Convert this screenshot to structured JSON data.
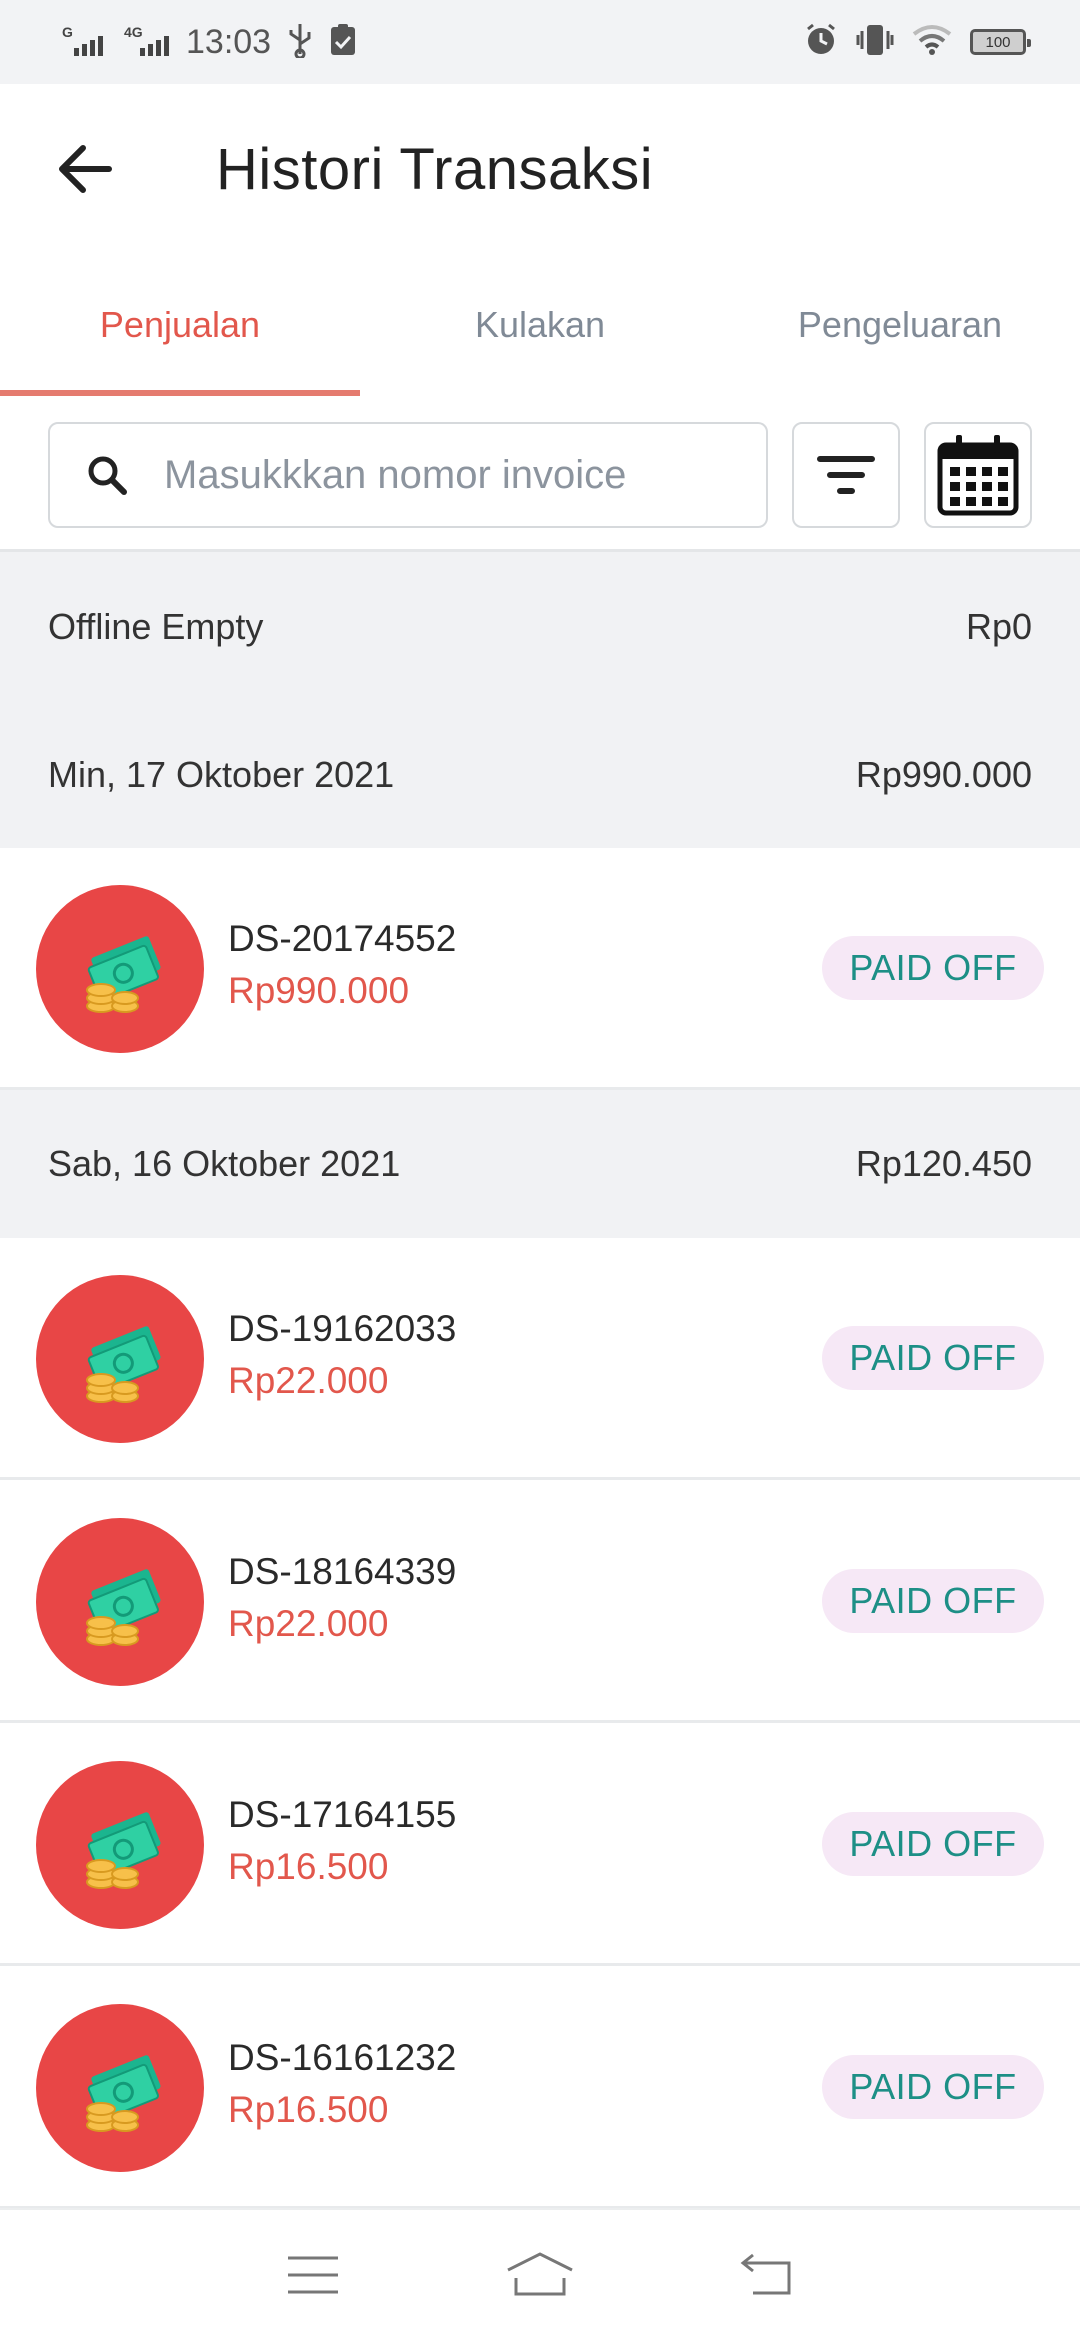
{
  "status_bar": {
    "network1": "G",
    "network2": "4G",
    "time": "13:03",
    "battery": "100",
    "icons": [
      "usb-icon",
      "clipboard-check-icon",
      "alarm-icon",
      "vibrate-icon",
      "wifi-icon",
      "battery-icon"
    ]
  },
  "header": {
    "title": "Histori Transaksi",
    "back_icon": "arrow-left-icon"
  },
  "tabs": [
    {
      "label": "Penjualan",
      "active": true
    },
    {
      "label": "Kulakan",
      "active": false
    },
    {
      "label": "Pengeluaran",
      "active": false
    }
  ],
  "search": {
    "placeholder": "Masukkkan nomor invoice",
    "value": "",
    "icon": "search-icon",
    "filter_icon": "filter-icon",
    "calendar_icon": "calendar-icon"
  },
  "offline": {
    "label": "Offline Empty",
    "amount": "Rp0"
  },
  "groups": [
    {
      "date": "Min, 17 Oktober 2021",
      "total": "Rp990.000",
      "transactions": [
        {
          "invoice": "DS-20174552",
          "amount": "Rp990.000",
          "status": "PAID OFF"
        }
      ]
    },
    {
      "date": "Sab, 16 Oktober 2021",
      "total": "Rp120.450",
      "transactions": [
        {
          "invoice": "DS-19162033",
          "amount": "Rp22.000",
          "status": "PAID OFF"
        },
        {
          "invoice": "DS-18164339",
          "amount": "Rp22.000",
          "status": "PAID OFF"
        },
        {
          "invoice": "DS-17164155",
          "amount": "Rp16.500",
          "status": "PAID OFF"
        },
        {
          "invoice": "DS-16161232",
          "amount": "Rp16.500",
          "status": "PAID OFF"
        }
      ]
    }
  ],
  "colors": {
    "accent": "#e2574c",
    "avatar_bg": "#e84646",
    "badge_bg": "#f6e8f6",
    "badge_text": "#1d8f86",
    "section_bg": "#f1f2f4"
  },
  "nav": [
    "menu-icon",
    "home-icon",
    "back-nav-icon"
  ]
}
